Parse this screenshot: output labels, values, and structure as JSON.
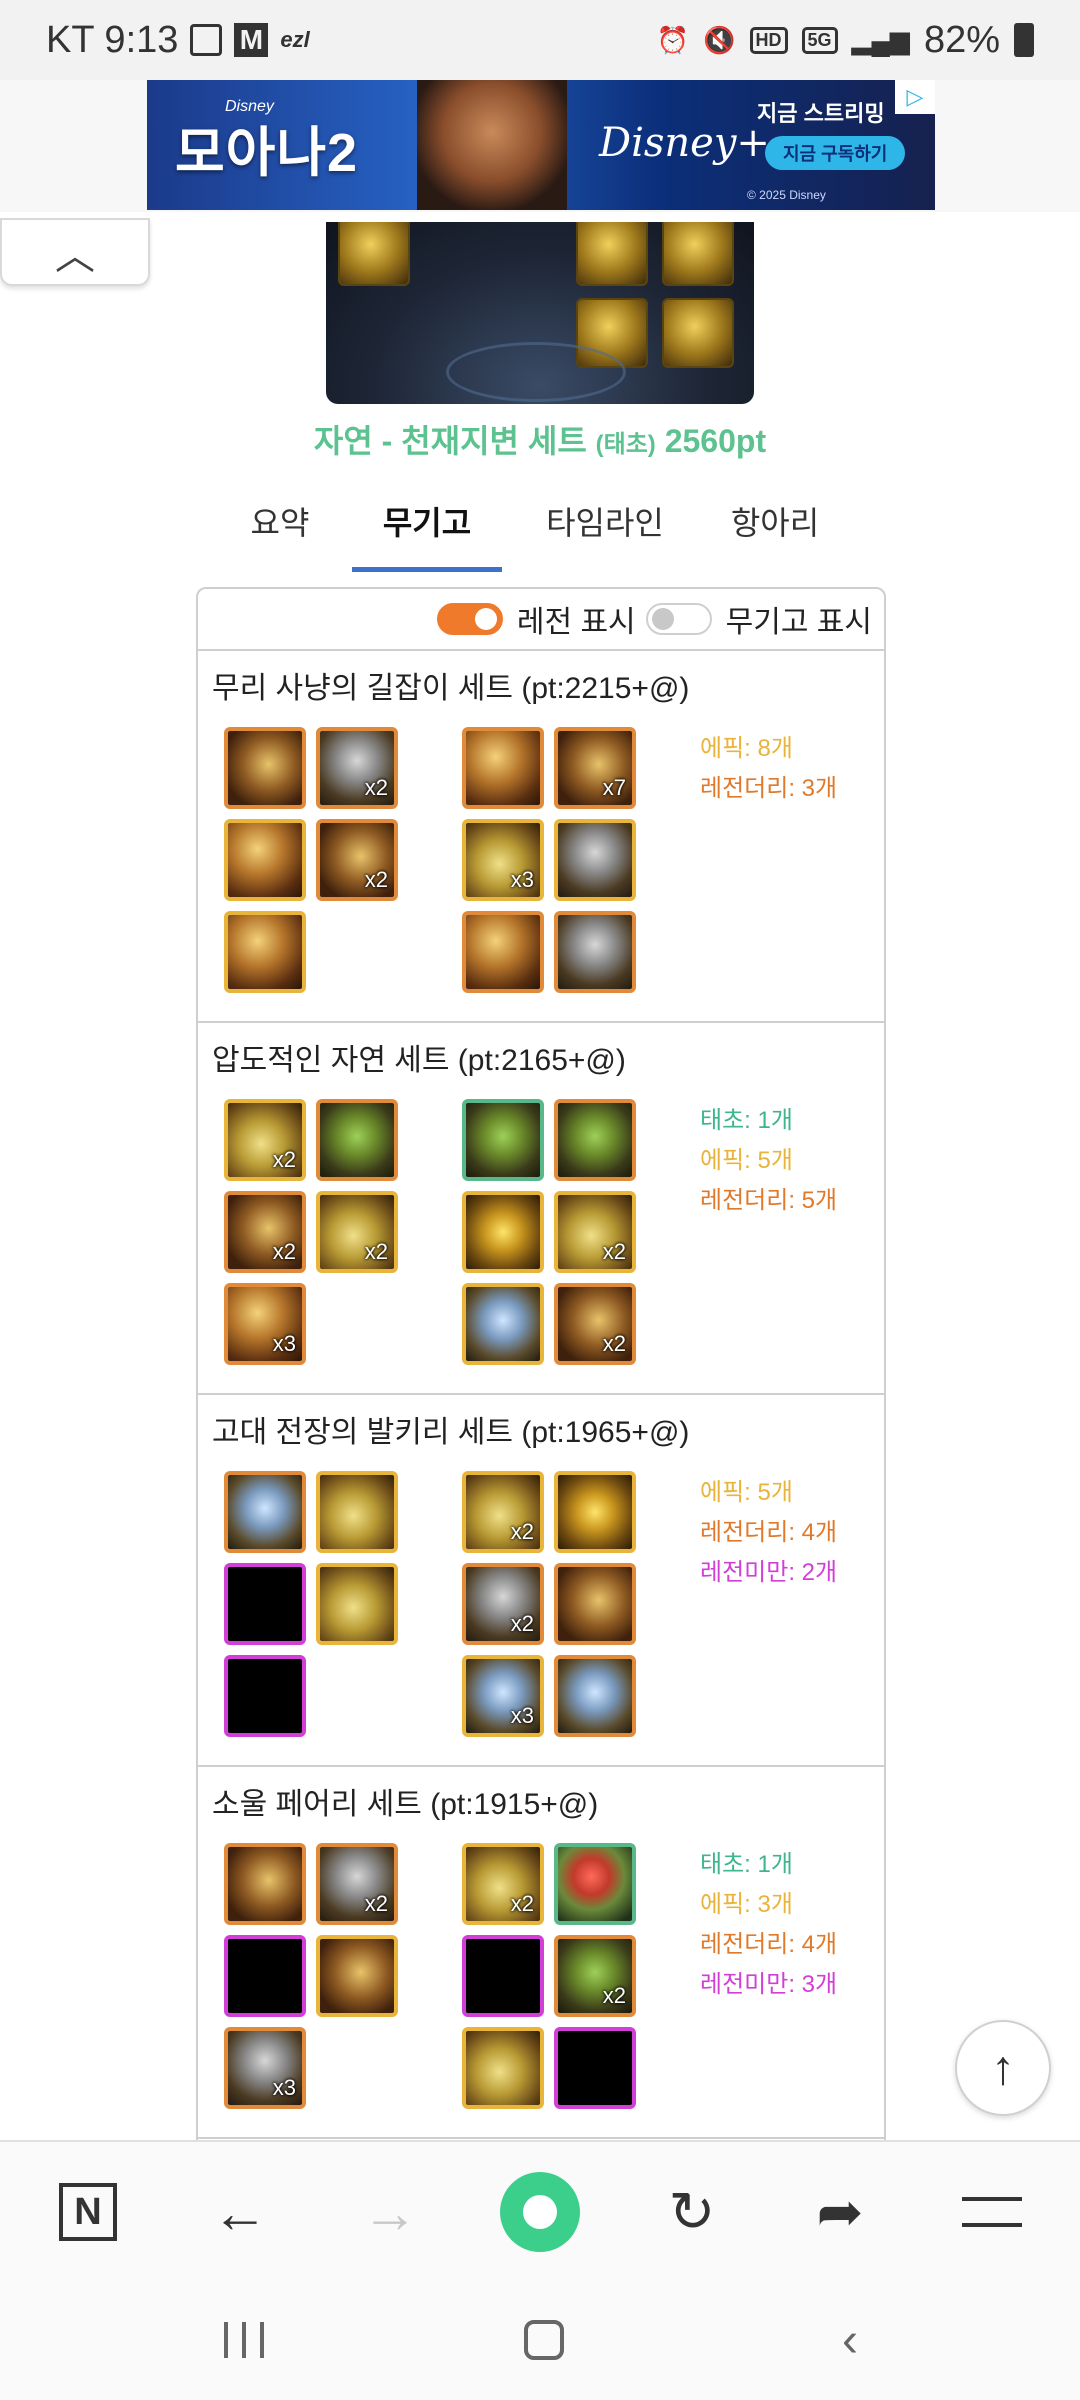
{
  "status_bar": {
    "carrier_time": "KT 9:13",
    "ezl": "ezl",
    "m_badge": "M",
    "hd": "HD",
    "network": "5G",
    "battery": "82%"
  },
  "ad": {
    "title": "모아나2",
    "disney_small": "Disney",
    "brand": "Disney+",
    "stream_text": "지금 스트리밍",
    "subscribe": "지금 구독하기",
    "copyright": "© 2025 Disney"
  },
  "hero": {
    "set_title": "자연 - 천재지변 세트",
    "set_tag": "(태초)",
    "set_points": "2560pt"
  },
  "tabs": [
    "요약",
    "무기고",
    "타임라인",
    "항아리"
  ],
  "active_tab": "무기고",
  "toggles": {
    "legend_label": "레전 표시",
    "legend_on": true,
    "armory_label": "무기고 표시",
    "armory_on": false
  },
  "sets": [
    {
      "name": "무리 사냥의 길잡이 세트 (pt:2215+@)",
      "left": [
        {
          "tier": "legend",
          "art": "art-b",
          "qty": ""
        },
        {
          "tier": "legend",
          "art": "art-d",
          "qty": "x2"
        },
        {
          "tier": "epic",
          "art": "art-a",
          "qty": ""
        },
        {
          "tier": "legend",
          "art": "art-b",
          "qty": "x2"
        },
        {
          "tier": "epic",
          "art": "art-a",
          "qty": ""
        }
      ],
      "right": [
        {
          "tier": "legend",
          "art": "art-a",
          "qty": ""
        },
        {
          "tier": "legend",
          "art": "art-b",
          "qty": "x7"
        },
        {
          "tier": "epic",
          "art": "art-c",
          "qty": "x3"
        },
        {
          "tier": "epic",
          "art": "art-d",
          "qty": ""
        },
        {
          "tier": "legend",
          "art": "art-a",
          "qty": ""
        },
        {
          "tier": "legend",
          "art": "art-d",
          "qty": ""
        }
      ],
      "summary": [
        {
          "text": "에픽: 8개",
          "kind": "epic"
        },
        {
          "text": "레전더리: 3개",
          "kind": "legend"
        }
      ]
    },
    {
      "name": "압도적인 자연 세트 (pt:2165+@)",
      "left": [
        {
          "tier": "epic",
          "art": "art-c",
          "qty": "x2"
        },
        {
          "tier": "legend",
          "art": "art-g",
          "qty": ""
        },
        {
          "tier": "legend",
          "art": "art-b",
          "qty": "x2"
        },
        {
          "tier": "epic",
          "art": "art-c",
          "qty": "x2"
        },
        {
          "tier": "legend",
          "art": "art-a",
          "qty": "x3"
        }
      ],
      "right": [
        {
          "tier": "taecho",
          "art": "art-g",
          "qty": ""
        },
        {
          "tier": "legend",
          "art": "art-g",
          "qty": ""
        },
        {
          "tier": "epic",
          "art": "art-e",
          "qty": ""
        },
        {
          "tier": "epic",
          "art": "art-c",
          "qty": "x2"
        },
        {
          "tier": "epic",
          "art": "art-h",
          "qty": ""
        },
        {
          "tier": "legend",
          "art": "art-b",
          "qty": "x2"
        }
      ],
      "summary": [
        {
          "text": "태초: 1개",
          "kind": "taecho"
        },
        {
          "text": "에픽: 5개",
          "kind": "epic"
        },
        {
          "text": "레전더리: 5개",
          "kind": "legend"
        }
      ]
    },
    {
      "name": "고대 전장의 발키리 세트 (pt:1965+@)",
      "left": [
        {
          "tier": "legend",
          "art": "art-h",
          "qty": ""
        },
        {
          "tier": "epic",
          "art": "art-c",
          "qty": ""
        },
        {
          "tier": "empty",
          "art": "",
          "qty": ""
        },
        {
          "tier": "epic",
          "art": "art-c",
          "qty": ""
        },
        {
          "tier": "empty",
          "art": "",
          "qty": ""
        }
      ],
      "right": [
        {
          "tier": "epic",
          "art": "art-c",
          "qty": "x2"
        },
        {
          "tier": "epic",
          "art": "art-e",
          "qty": ""
        },
        {
          "tier": "legend",
          "art": "art-d",
          "qty": "x2"
        },
        {
          "tier": "legend",
          "art": "art-b",
          "qty": ""
        },
        {
          "tier": "epic",
          "art": "art-h",
          "qty": "x3"
        },
        {
          "tier": "legend",
          "art": "art-h",
          "qty": ""
        }
      ],
      "summary": [
        {
          "text": "에픽: 5개",
          "kind": "epic"
        },
        {
          "text": "레전더리: 4개",
          "kind": "legend"
        },
        {
          "text": "레전미만: 2개",
          "kind": "sub"
        }
      ]
    },
    {
      "name": "소울 페어리 세트 (pt:1915+@)",
      "left": [
        {
          "tier": "legend",
          "art": "art-b",
          "qty": ""
        },
        {
          "tier": "legend",
          "art": "art-d",
          "qty": "x2"
        },
        {
          "tier": "empty",
          "art": "",
          "qty": ""
        },
        {
          "tier": "epic",
          "art": "art-b",
          "qty": ""
        },
        {
          "tier": "legend",
          "art": "art-d",
          "qty": "x3"
        }
      ],
      "right": [
        {
          "tier": "epic",
          "art": "art-c",
          "qty": "x2"
        },
        {
          "tier": "taecho",
          "art": "art-f",
          "qty": ""
        },
        {
          "tier": "empty",
          "art": "",
          "qty": ""
        },
        {
          "tier": "legend",
          "art": "art-g",
          "qty": "x2"
        },
        {
          "tier": "epic",
          "art": "art-c",
          "qty": ""
        },
        {
          "tier": "empty",
          "art": "",
          "qty": ""
        }
      ],
      "summary": [
        {
          "text": "태초: 1개",
          "kind": "taecho"
        },
        {
          "text": "에픽: 3개",
          "kind": "epic"
        },
        {
          "text": "레전더리: 4개",
          "kind": "legend"
        },
        {
          "text": "레전미만: 3개",
          "kind": "sub"
        }
      ]
    }
  ],
  "colors": {
    "set_title": "#5cc28f",
    "tab_active": "#3a73c9",
    "toggle_on": "#ef7a2b",
    "taecho": "#3eb58c",
    "epic": "#e8b43a",
    "legend": "#e07a2a",
    "sub_legend": "#d23fd6"
  }
}
